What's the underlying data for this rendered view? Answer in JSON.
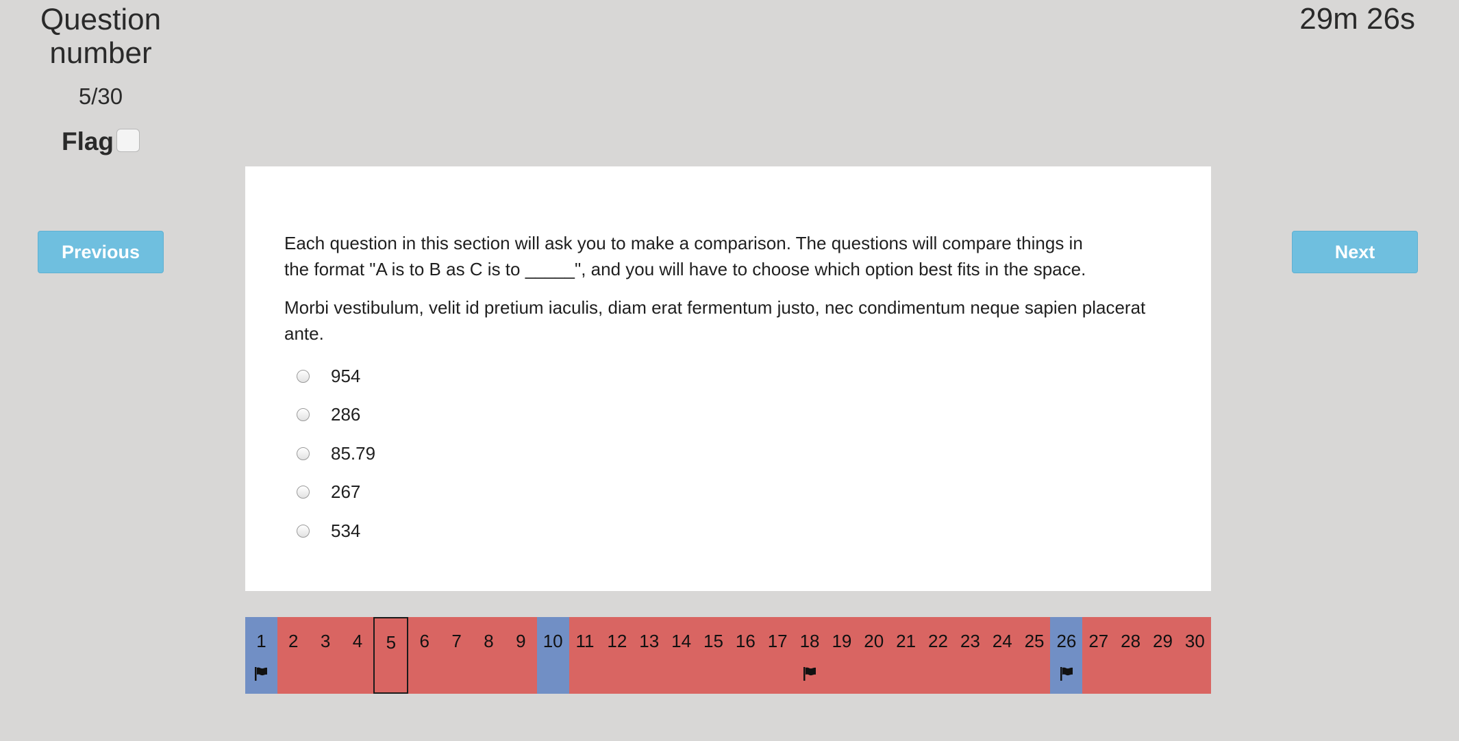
{
  "header": {
    "question_label": "Question number",
    "question_progress": "5/30",
    "flag_label": "Flag",
    "flag_checked": false,
    "timer": "29m 26s"
  },
  "buttons": {
    "previous": "Previous",
    "next": "Next"
  },
  "question": {
    "instructions": "Each question in this section will ask you to make a comparison. The questions will compare things in the format \"A is to B as C is to _____\", and you will have to choose which option best fits in the space.",
    "prompt": "Morbi vestibulum, velit id pretium iaculis, diam erat fermentum justo, nec condimentum neque sapien placerat ante.",
    "options": [
      {
        "label": "954",
        "selected": false
      },
      {
        "label": "286",
        "selected": false
      },
      {
        "label": "85.79",
        "selected": false
      },
      {
        "label": "267",
        "selected": false
      },
      {
        "label": "534",
        "selected": false
      }
    ]
  },
  "navigator": {
    "current": 5,
    "colors": {
      "unanswered": "#d96562",
      "answered": "#718fc5",
      "current_border": "#1a1a1a"
    },
    "items": [
      {
        "number": "1",
        "status": "answered",
        "flagged": true
      },
      {
        "number": "2",
        "status": "unanswered",
        "flagged": false
      },
      {
        "number": "3",
        "status": "unanswered",
        "flagged": false
      },
      {
        "number": "4",
        "status": "unanswered",
        "flagged": false
      },
      {
        "number": "5",
        "status": "unanswered",
        "flagged": false
      },
      {
        "number": "6",
        "status": "unanswered",
        "flagged": false
      },
      {
        "number": "7",
        "status": "unanswered",
        "flagged": false
      },
      {
        "number": "8",
        "status": "unanswered",
        "flagged": false
      },
      {
        "number": "9",
        "status": "unanswered",
        "flagged": false
      },
      {
        "number": "10",
        "status": "answered",
        "flagged": false
      },
      {
        "number": "11",
        "status": "unanswered",
        "flagged": false
      },
      {
        "number": "12",
        "status": "unanswered",
        "flagged": false
      },
      {
        "number": "13",
        "status": "unanswered",
        "flagged": false
      },
      {
        "number": "14",
        "status": "unanswered",
        "flagged": false
      },
      {
        "number": "15",
        "status": "unanswered",
        "flagged": false
      },
      {
        "number": "16",
        "status": "unanswered",
        "flagged": false
      },
      {
        "number": "17",
        "status": "unanswered",
        "flagged": false
      },
      {
        "number": "18",
        "status": "unanswered",
        "flagged": true
      },
      {
        "number": "19",
        "status": "unanswered",
        "flagged": false
      },
      {
        "number": "20",
        "status": "unanswered",
        "flagged": false
      },
      {
        "number": "21",
        "status": "unanswered",
        "flagged": false
      },
      {
        "number": "22",
        "status": "unanswered",
        "flagged": false
      },
      {
        "number": "23",
        "status": "unanswered",
        "flagged": false
      },
      {
        "number": "24",
        "status": "unanswered",
        "flagged": false
      },
      {
        "number": "25",
        "status": "unanswered",
        "flagged": false
      },
      {
        "number": "26",
        "status": "answered",
        "flagged": true
      },
      {
        "number": "27",
        "status": "unanswered",
        "flagged": false
      },
      {
        "number": "28",
        "status": "unanswered",
        "flagged": false
      },
      {
        "number": "29",
        "status": "unanswered",
        "flagged": false
      },
      {
        "number": "30",
        "status": "unanswered",
        "flagged": false
      }
    ]
  }
}
